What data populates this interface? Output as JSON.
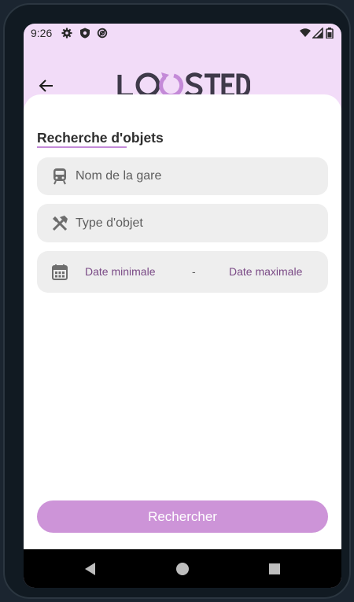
{
  "status_bar": {
    "time": "9:26",
    "left_icons": [
      "settings-icon",
      "shield-icon",
      "sync-icon"
    ],
    "right_icons": [
      "wifi-icon",
      "signal-icon",
      "battery-icon"
    ]
  },
  "app_bar": {
    "logo_text": "LOOSTED",
    "back_icon": "arrow-left-icon"
  },
  "search": {
    "section_title": "Recherche d'objets",
    "station_placeholder": "Nom de la gare",
    "station_icon": "train-icon",
    "type_placeholder": "Type d'objet",
    "type_icon": "tools-icon",
    "date_icon": "calendar-icon",
    "date_min": "Date minimale",
    "date_separator": "-",
    "date_max": "Date maximale",
    "submit_label": "Rechercher"
  },
  "nav_bar": {
    "buttons": [
      "back-triangle-icon",
      "home-circle-icon",
      "recents-square-icon"
    ]
  },
  "colors": {
    "header_bg": "#f2dcf8",
    "accent": "#c48ad8",
    "button": "#cd94d8",
    "field_bg": "#eeeeee",
    "date_text": "#7a4a86",
    "logo_dark": "#3f3a4a"
  }
}
